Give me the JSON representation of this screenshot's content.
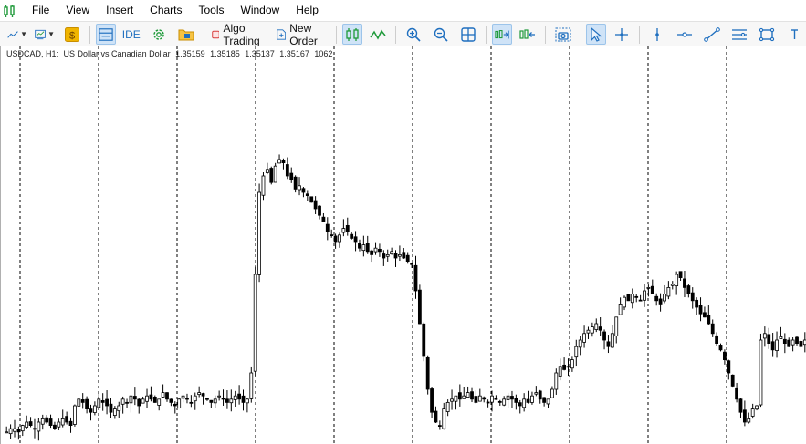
{
  "menu": {
    "items": [
      "File",
      "View",
      "Insert",
      "Charts",
      "Tools",
      "Window",
      "Help"
    ]
  },
  "toolbar": {
    "ide_label": "IDE",
    "algo_trading_label": "Algo Trading",
    "new_order_label": "New Order"
  },
  "colors": {
    "candle": "#000000",
    "grid": "#000000",
    "chart_background": "#ffffff",
    "toolbar_active": "#cfe3f7",
    "icon_blue": "#1f6fbf",
    "icon_green": "#1f9a3a",
    "algo_red": "#d83a3a",
    "gold": "#f0b400"
  },
  "chart": {
    "info": {
      "symbol_tf": "USDCAD, H1:",
      "description": "US Dollar vs Canadian Dollar",
      "open": "1.35159",
      "high": "1.35185",
      "low": "1.35137",
      "close": "1.35167",
      "tick_volume": "1062"
    }
  },
  "chart_data": {
    "type": "candlestick",
    "title": "USDCAD, H1: US Dollar vs Canadian Dollar",
    "close_profile": [
      0.02,
      0.03,
      0.03,
      0.02,
      0.04,
      0.05,
      0.04,
      0.03,
      0.05,
      0.06,
      0.05,
      0.04,
      0.03,
      0.05,
      0.06,
      0.05,
      0.04,
      0.1,
      0.12,
      0.11,
      0.09,
      0.08,
      0.1,
      0.12,
      0.11,
      0.1,
      0.08,
      0.09,
      0.1,
      0.12,
      0.11,
      0.13,
      0.12,
      0.1,
      0.12,
      0.13,
      0.12,
      0.11,
      0.12,
      0.14,
      0.12,
      0.11,
      0.1,
      0.12,
      0.13,
      0.12,
      0.11,
      0.13,
      0.14,
      0.13,
      0.12,
      0.11,
      0.12,
      0.13,
      0.12,
      0.11,
      0.12,
      0.13,
      0.12,
      0.11,
      0.12,
      0.2,
      0.5,
      0.75,
      0.8,
      0.82,
      0.78,
      0.83,
      0.85,
      0.84,
      0.8,
      0.79,
      0.76,
      0.77,
      0.75,
      0.74,
      0.72,
      0.7,
      0.68,
      0.66,
      0.63,
      0.62,
      0.6,
      0.62,
      0.64,
      0.63,
      0.61,
      0.6,
      0.58,
      0.59,
      0.57,
      0.56,
      0.58,
      0.57,
      0.55,
      0.56,
      0.57,
      0.55,
      0.56,
      0.55,
      0.54,
      0.53,
      0.45,
      0.35,
      0.25,
      0.15,
      0.08,
      0.05,
      0.04,
      0.09,
      0.11,
      0.12,
      0.13,
      0.12,
      0.13,
      0.14,
      0.12,
      0.11,
      0.13,
      0.12,
      0.11,
      0.13,
      0.12,
      0.11,
      0.12,
      0.13,
      0.12,
      0.11,
      0.1,
      0.12,
      0.11,
      0.13,
      0.14,
      0.12,
      0.11,
      0.12,
      0.15,
      0.2,
      0.22,
      0.21,
      0.22,
      0.24,
      0.28,
      0.3,
      0.32,
      0.33,
      0.34,
      0.35,
      0.33,
      0.3,
      0.28,
      0.32,
      0.37,
      0.41,
      0.43,
      0.42,
      0.44,
      0.43,
      0.42,
      0.45,
      0.46,
      0.44,
      0.42,
      0.41,
      0.44,
      0.46,
      0.47,
      0.5,
      0.49,
      0.46,
      0.44,
      0.42,
      0.4,
      0.38,
      0.37,
      0.35,
      0.32,
      0.29,
      0.27,
      0.24,
      0.2,
      0.16,
      0.12,
      0.08,
      0.05,
      0.06,
      0.09,
      0.1,
      0.3,
      0.32,
      0.29,
      0.27,
      0.3,
      0.31,
      0.29,
      0.28,
      0.3,
      0.29,
      0.28,
      0.3
    ],
    "vertical_separators": 10
  }
}
